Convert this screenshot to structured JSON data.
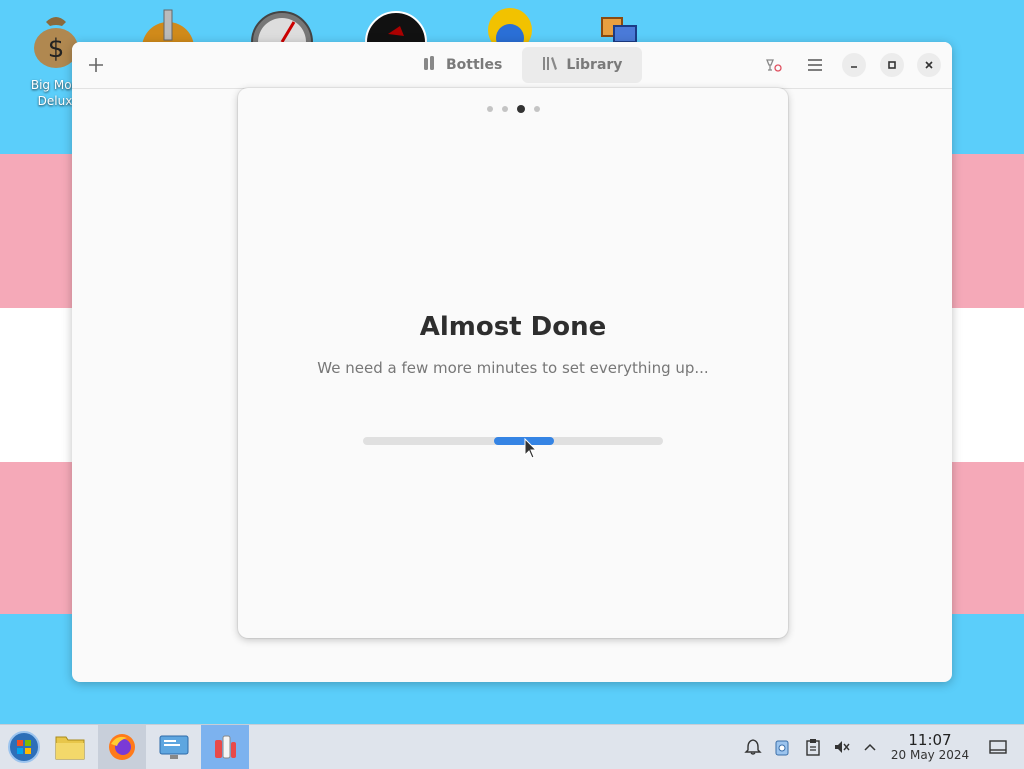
{
  "desktop": {
    "icons": [
      {
        "name": "money-bag-icon",
        "label": "Big Money Deluxe"
      },
      {
        "name": "gear-cog-icon"
      },
      {
        "name": "gauge-icon"
      },
      {
        "name": "dark-disc-icon"
      },
      {
        "name": "sun-globe-icon"
      },
      {
        "name": "window-app-icon"
      }
    ],
    "visible_label_lines": [
      "Big Mon",
      "Delux"
    ]
  },
  "window": {
    "switcher": {
      "tabs": [
        {
          "label": "Bottles",
          "icon": "bottles-icon",
          "active": false
        },
        {
          "label": "Library",
          "icon": "library-icon",
          "active": true
        }
      ]
    },
    "header_icons": [
      "add-icon",
      "wine-glasses-icon",
      "hamburger-menu-icon",
      "minimize-icon",
      "maximize-icon",
      "close-icon"
    ]
  },
  "dialog": {
    "page_count": 4,
    "current_page": 3,
    "title": "Almost Done",
    "subtitle": "We need a few more minutes to set everything up...",
    "progress_state": "indeterminate (pulsing)"
  },
  "taskbar": {
    "launcher_icon": "start-menu-icon",
    "tasks": [
      {
        "name": "file-manager-icon"
      },
      {
        "name": "firefox-icon"
      },
      {
        "name": "system-settings-icon"
      },
      {
        "name": "bottles-app-icon"
      }
    ],
    "tray": [
      "notifications-icon",
      "vault-icon",
      "clipboard-icon",
      "volume-muted-icon",
      "tray-expand-icon"
    ],
    "clock": {
      "time": "11:07",
      "date": "20 May 2024"
    }
  },
  "colors": {
    "accent": "#3584e4",
    "wallpaper_blue": "#5bcefa",
    "wallpaper_pink": "#f5a9b8",
    "wallpaper_white": "#ffffff"
  }
}
